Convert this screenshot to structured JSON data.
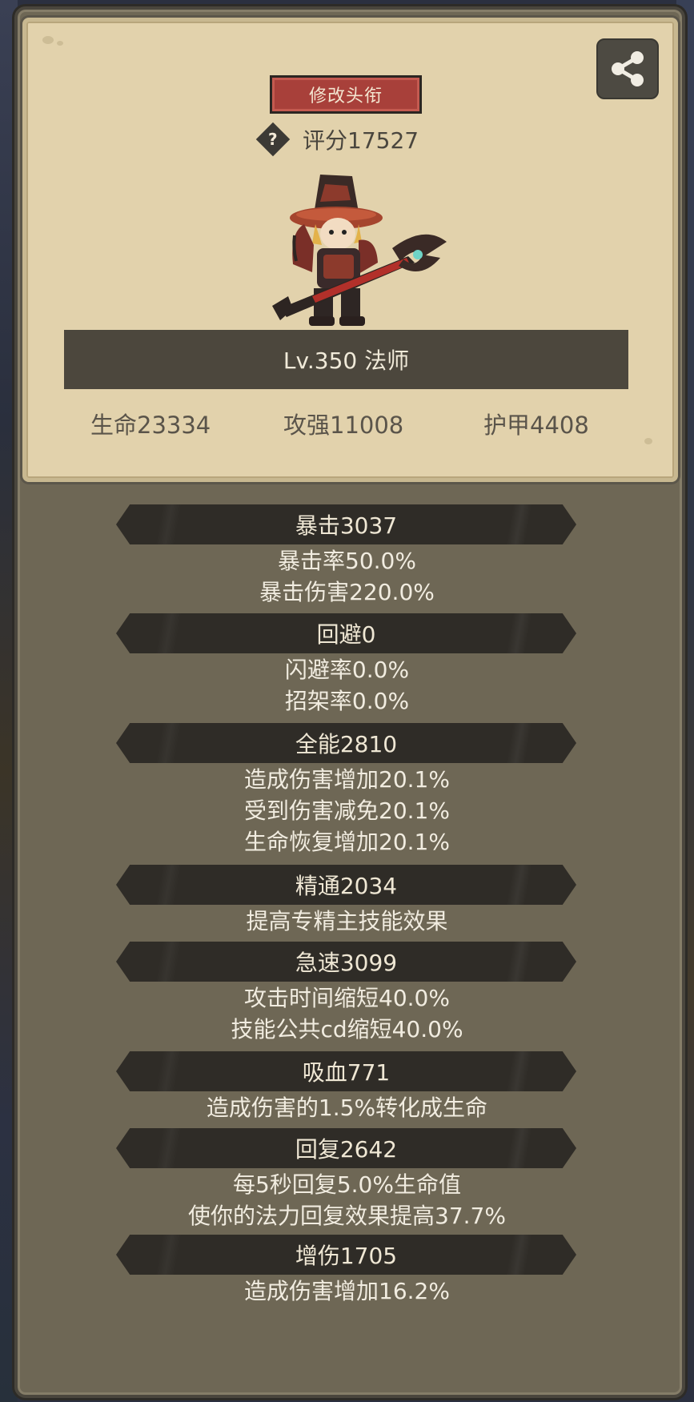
{
  "header": {
    "edit_title_label": "修改头衔",
    "score_label": "评分17527",
    "help_symbol": "?",
    "share_icon": "share-icon"
  },
  "character": {
    "level_class": "Lv.350 法师"
  },
  "basic_stats": {
    "hp": "生命23334",
    "attack": "攻强11008",
    "armor": "护甲4408"
  },
  "stat_sections": [
    {
      "header": "暴击3037",
      "lines": [
        "暴击率50.0%",
        "暴击伤害220.0%"
      ]
    },
    {
      "header": "回避0",
      "lines": [
        "闪避率0.0%",
        "招架率0.0%"
      ]
    },
    {
      "header": "全能2810",
      "lines": [
        "造成伤害增加20.1%",
        "受到伤害减免20.1%",
        "生命恢复增加20.1%"
      ]
    },
    {
      "header": "精通2034",
      "lines": [
        "提高专精主技能效果"
      ]
    },
    {
      "header": "急速3099",
      "lines": [
        "攻击时间缩短40.0%",
        "技能公共cd缩短40.0%"
      ]
    },
    {
      "header": "吸血771",
      "lines": [
        "造成伤害的1.5%转化成生命"
      ]
    },
    {
      "header": "回复2642",
      "lines": [
        "每5秒回复5.0%生命值",
        "使你的法力回复效果提高37.7%"
      ]
    },
    {
      "header": "增伤1705",
      "lines": [
        "造成伤害增加16.2%"
      ]
    }
  ],
  "colors": {
    "panel": "#e2d2ac",
    "frame": "#6e6755",
    "title_button": "#a8403a",
    "section_header": "#2f2c27"
  }
}
